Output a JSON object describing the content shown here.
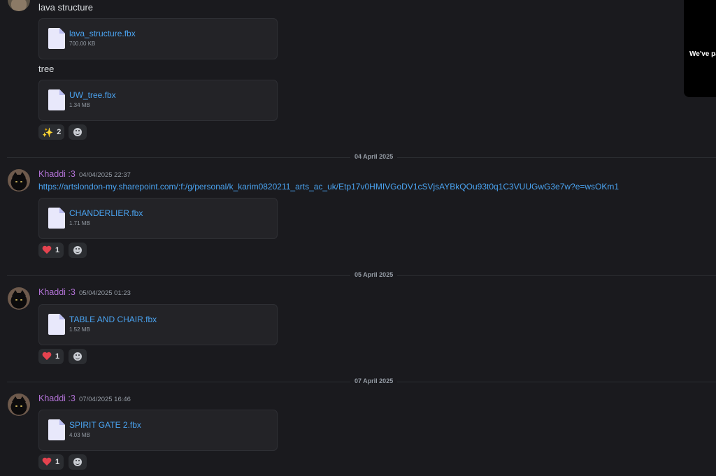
{
  "messages": {
    "lava": {
      "text": "lava structure",
      "file_name": "lava_structure.fbx",
      "file_size": "700.00 KB"
    },
    "tree": {
      "text": "tree",
      "file_name": "UW_tree.fbx",
      "file_size": "1.34 MB",
      "reaction_emoji": "✨",
      "reaction_count": "2"
    },
    "group1": {
      "date_divider": "04 April 2025",
      "username": "Khaddi :3",
      "timestamp": "04/04/2025 22:37",
      "link": "https://artslondon-my.sharepoint.com/:f:/g/personal/k_karim0820211_arts_ac_uk/Etp17v0HMIVGoDV1cSVjsAYBkQOu93t0q1C3VUUGwG3e7w?e=wsOKm1",
      "file_name": "CHANDERLIER.fbx",
      "file_size": "1.71 MB",
      "reaction_count": "1"
    },
    "group2": {
      "date_divider": "05 April 2025",
      "username": "Khaddi :3",
      "timestamp": "05/04/2025 01:23",
      "file_name": "TABLE AND CHAIR.fbx",
      "file_size": "1.52 MB",
      "reaction_count": "1"
    },
    "group3": {
      "date_divider": "07 April 2025",
      "username": "Khaddi :3",
      "timestamp": "07/04/2025 16:46",
      "file_name": "SPIRIT GATE 2.fbx",
      "file_size": "4.03 MB",
      "reaction_count": "1"
    }
  },
  "popup": {
    "text": "We've pa"
  },
  "icons": {
    "file": "file-icon",
    "heart": "heart-icon",
    "sparkles": "sparkles-icon",
    "add_reaction": "add-reaction-icon"
  },
  "colors": {
    "background": "#1a1a1e",
    "username": "#b272d6",
    "link": "#4aa3f0",
    "heart": "#e5434f"
  }
}
